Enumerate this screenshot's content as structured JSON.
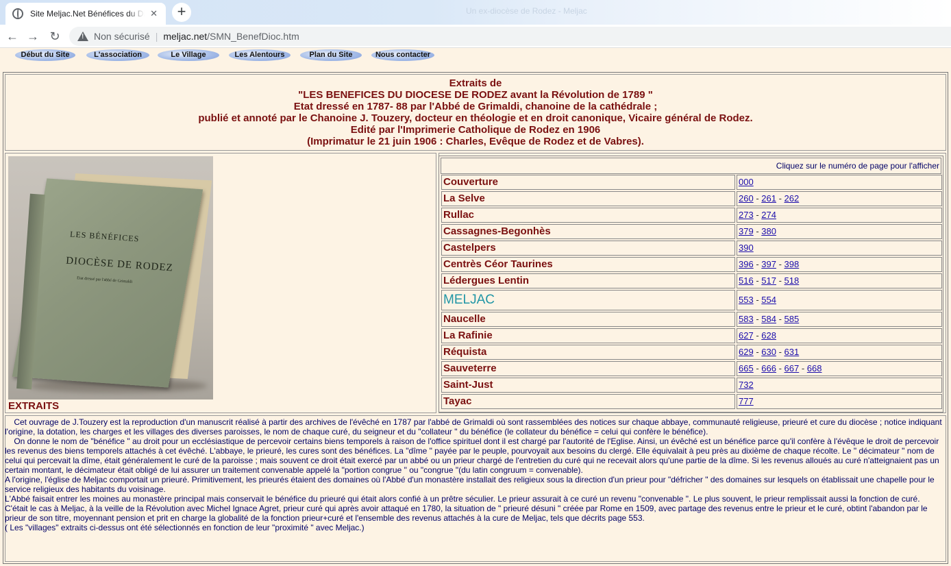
{
  "browser": {
    "tab_title": "Site Meljac.Net Bénéfices du Dioc",
    "tab_close": "✕",
    "new_tab": "+",
    "faint_title": "Un ex-diocèse de Rodez - Meljac",
    "nav_back": "←",
    "nav_forward": "→",
    "nav_reload": "↻",
    "not_secure": "Non sécurisé",
    "url_host": "meljac.net",
    "url_path": "/SMN_BenefDioc.htm"
  },
  "nav": [
    {
      "label": "Début du Site"
    },
    {
      "label": "L'association"
    },
    {
      "label": "Le Village"
    },
    {
      "label": "Les Alentours"
    },
    {
      "label": "Plan du Site"
    },
    {
      "label": "Nous contacter"
    }
  ],
  "header": {
    "line1": "Extraits de",
    "line2": "\"LES BENEFICES DU DIOCESE DE RODEZ avant la Révolution de 1789 \"",
    "line3": "Etat dressé en 1787- 88 par l'Abbé de Grimaldi, chanoine de la cathédrale ;",
    "line4": "publié et annoté par le Chanoine J. Touzery, docteur en théologie et en droit canonique, Vicaire général de Rodez.",
    "line5": "Edité par l'Imprimerie Catholique de Rodez en 1906",
    "line6": "(Imprimatur le 21 juin 1906 : Charles, Evêque de Rodez et de Vabres)."
  },
  "book": {
    "cover_line1": "LES BÉNÉFICES",
    "cover_line2": "DIOCÈSE DE RODEZ",
    "cover_line3": "Etat dressé par l'abbé de Grimaldi",
    "caption": "EXTRAITS"
  },
  "table": {
    "hint": "Cliquez sur le numéro de page pour l'afficher",
    "rows": [
      {
        "name": "Couverture",
        "pages": [
          "000"
        ]
      },
      {
        "name": "La Selve",
        "pages": [
          "260",
          "261",
          "262"
        ]
      },
      {
        "name": "Rullac",
        "pages": [
          "273",
          "274"
        ]
      },
      {
        "name": "Cassagnes-Begonhès",
        "pages": [
          "379",
          "380"
        ]
      },
      {
        "name": "Castelpers",
        "pages": [
          "390"
        ]
      },
      {
        "name": "Centrès Céor Taurines",
        "pages": [
          "396",
          "397",
          "398"
        ]
      },
      {
        "name": "Lédergues Lentin",
        "pages": [
          "516",
          "517",
          "518"
        ]
      },
      {
        "name": "MELJAC",
        "pages": [
          "553",
          "554"
        ]
      },
      {
        "name": "Naucelle",
        "pages": [
          "583",
          "584",
          "585"
        ]
      },
      {
        "name": "La Rafinie",
        "pages": [
          "627",
          "628"
        ]
      },
      {
        "name": "Réquista",
        "pages": [
          "629",
          "630",
          "631"
        ]
      },
      {
        "name": "Sauveterre",
        "pages": [
          "665",
          "666",
          "667",
          "668"
        ]
      },
      {
        "name": "Saint-Just",
        "pages": [
          "732"
        ]
      },
      {
        "name": "Tayac",
        "pages": [
          "777"
        ]
      }
    ]
  },
  "body": {
    "p1": "    Cet ouvrage de J.Touzery est la reproduction d'un manuscrit réalisé à partir des archives de l'évêché en 1787 par l'abbé de Grimaldi où sont rassemblées des notices sur chaque abbaye, communauté religieuse, prieuré et cure du diocèse ; notice indiquant l'origine, la dotation, les charges et les villages des diverses paroisses, le nom de chaque curé, du seigneur et du \"collateur \" du bénéfice (le collateur du bénéfice = celui qui confère le bénéfice).",
    "p2": "    On donne le nom de \"bénéfice \" au droit pour un ecclésiastique de percevoir certains biens temporels à raison de l'office spirituel dont il est chargé par l'autorité de l'Eglise. Ainsi, un évêché est un bénéfice parce qu'il confère à l'évêque le droit de percevoir les revenus des biens temporels attachés à cet évêché. L'abbaye, le prieuré, les cures sont des bénéfices. La \"dîme \" payée par le peuple, pourvoyait aux besoins du clergé. Elle équivalait à peu près au dixième de chaque récolte. Le \" décimateur \" nom de celui qui percevait la dîme, était généralement le curé de la paroisse ; mais souvent ce droit était exercé par un abbé ou un prieur chargé de l'entretien du curé qui ne recevait alors qu'une partie de la dîme. Si les revenus alloués au curé n'atteignaient pas un certain montant, le décimateur était obligé de lui assurer un traitement convenable appelé la \"portion congrue \" ou \"congrue \"(du latin congruum = convenable).",
    "p3": "A l'origine, l'église de Meljac comportait un prieuré. Primitivement, les prieurés étaient des domaines où l'Abbé d'un monastère installait des religieux sous la direction d'un prieur pour \"défricher \" des domaines sur lesquels on établissait une chapelle pour le service religieux des habitants du voisinage.",
    "p4": "L'Abbé faisait entrer les moines au monastère principal mais conservait le bénéfice du prieuré qui était alors confié à un prêtre séculier. Le prieur assurait à ce curé un revenu \"convenable \". Le plus souvent, le prieur remplissait aussi la fonction de curé.",
    "p5": "C'était le cas à Meljac, à la veille de la Révolution avec Michel Ignace Agret, prieur curé qui après avoir attaqué en 1780, la situation de \" prieuré désuni \" créée par Rome en 1509, avec partage des revenus entre le prieur et le curé, obtint l'abandon par le prieur de son titre, moyennant pension et prit en charge la globalité de la fonction prieur+curé et l'ensemble des revenus attachés à la cure de Meljac, tels que décrits page 553.",
    "p6": "( Les \"villages\" extraits ci-dessus ont été sélectionnés en fonction de leur \"proximité \" avec Meljac.)"
  }
}
